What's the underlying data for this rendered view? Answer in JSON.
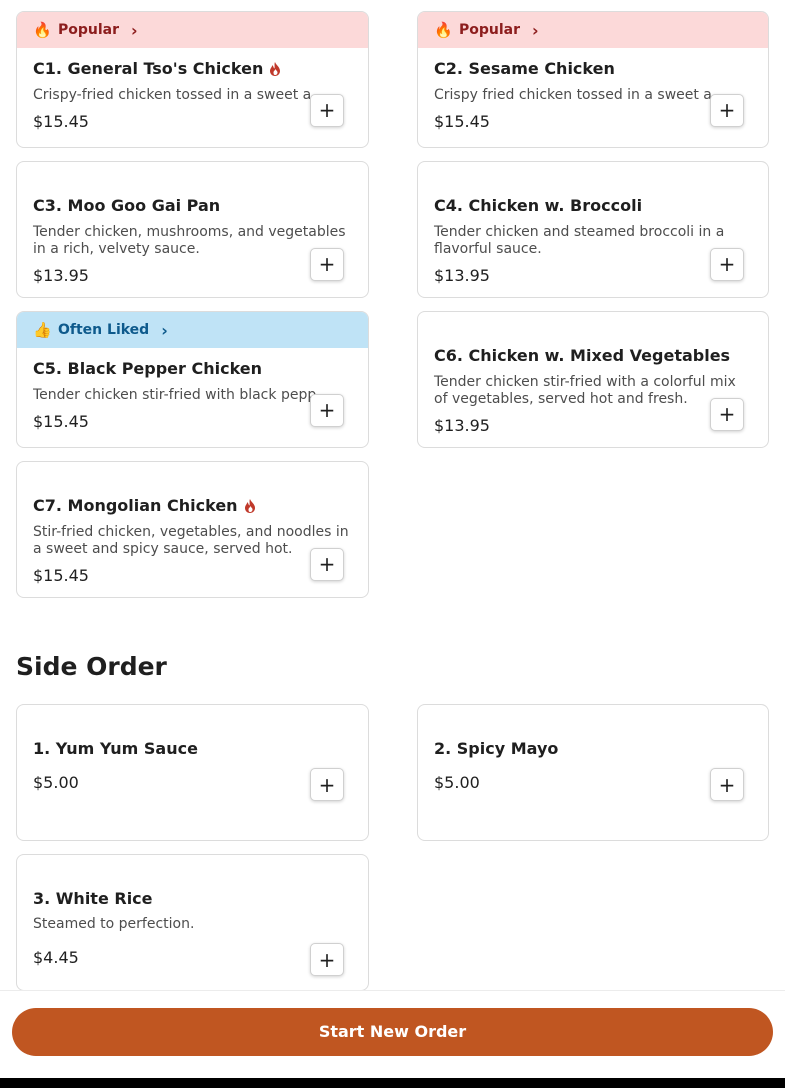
{
  "chicken_items": [
    {
      "badge": {
        "type": "popular",
        "emoji": "🔥",
        "label": "Popular"
      },
      "name": "C1. General Tso's Chicken",
      "spicy": true,
      "desc": "Crispy-fried chicken tossed in a sweet a...",
      "desc_clip": true,
      "price": "$15.45"
    },
    {
      "badge": {
        "type": "popular",
        "emoji": "🔥",
        "label": "Popular"
      },
      "name": "C2. Sesame Chicken",
      "spicy": false,
      "desc": "Crispy fried chicken tossed in a sweet a...",
      "desc_clip": true,
      "price": "$15.45"
    },
    {
      "badge": null,
      "name": "C3. Moo Goo Gai Pan",
      "spicy": false,
      "desc": "Tender chicken, mushrooms, and vegetables in a rich, velvety sauce.",
      "desc_clip": false,
      "price": "$13.95"
    },
    {
      "badge": null,
      "name": "C4. Chicken w. Broccoli",
      "spicy": false,
      "desc": "Tender chicken and steamed broccoli in a flavorful sauce.",
      "desc_clip": false,
      "price": "$13.95"
    },
    {
      "badge": {
        "type": "liked",
        "emoji": "👍👍",
        "label": "Often Liked"
      },
      "name": "C5. Black Pepper Chicken",
      "spicy": false,
      "desc": "Tender chicken stir-fried with black pepp...",
      "desc_clip": true,
      "price": "$15.45"
    },
    {
      "badge": null,
      "name": "C6. Chicken w. Mixed Vegetables",
      "spicy": false,
      "desc": "Tender chicken stir-fried with a colorful mix of vegetables, served hot and fresh.",
      "desc_clip": false,
      "price": "$13.95"
    },
    {
      "badge": null,
      "name": "C7. Mongolian Chicken",
      "spicy": true,
      "desc": "Stir-fried chicken, vegetables, and noodles in a sweet and spicy sauce, served hot.",
      "desc_clip": false,
      "price": "$15.45"
    }
  ],
  "side_section": {
    "title": "Side Order"
  },
  "side_items": [
    {
      "name": "1. Yum Yum Sauce",
      "desc": "",
      "price": "$5.00"
    },
    {
      "name": "2. Spicy Mayo",
      "desc": "",
      "price": "$5.00"
    },
    {
      "name": "3. White Rice",
      "desc": "Steamed to perfection.",
      "price": "$4.45"
    }
  ],
  "add_label": "+",
  "chevron_glyph": "›",
  "footer": {
    "cta_label": "Start New Order"
  },
  "colors": {
    "accent": "#c05621",
    "popular_bg": "#fcd9d9",
    "popular_text": "#8c1d1d",
    "liked_bg": "#bfe3f6",
    "liked_text": "#0e5a8c",
    "flame": "#c0392b"
  }
}
